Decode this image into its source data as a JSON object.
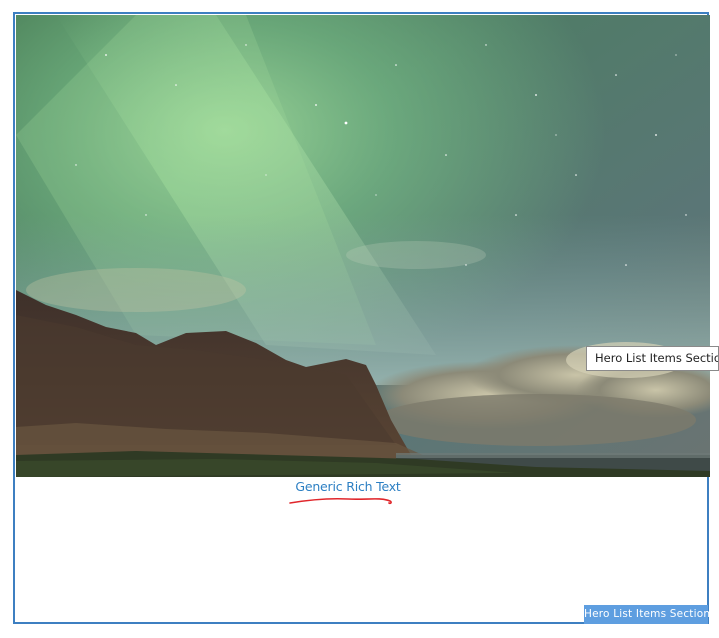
{
  "section": {
    "name": "Hero List Items Section",
    "tooltip": "Hero List Items Section",
    "badge": "Hero List Items Section",
    "border_color": "#3d7fc1",
    "badge_color": "#5e9ee0"
  },
  "hero": {
    "image_subject": "aurora-mountain-landscape"
  },
  "rich_text": {
    "label": "Generic Rich Text",
    "color": "#2c7fc3",
    "underline_color": "#e0262b"
  }
}
